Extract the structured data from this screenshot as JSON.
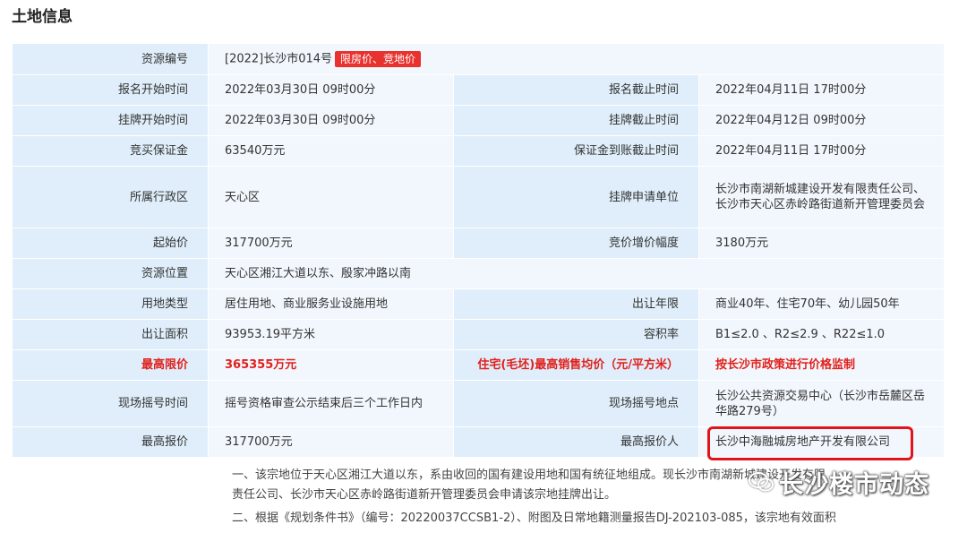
{
  "section_title": "土地信息",
  "rows": {
    "r1": {
      "l1": "资源编号",
      "v1": "[2022]长沙市014号",
      "tag": "限房价、竞地价"
    },
    "r2": {
      "l1": "报名开始时间",
      "v1": "2022年03月30日 09时00分",
      "l2": "报名截止时间",
      "v2": "2022年04月11日 17时00分"
    },
    "r3": {
      "l1": "挂牌开始时间",
      "v1": "2022年03月30日 09时00分",
      "l2": "挂牌截止时间",
      "v2": "2022年04月12日 09时00分"
    },
    "r4": {
      "l1": "竞买保证金",
      "v1": "63540万元",
      "l2": "保证金到账截止时间",
      "v2": "2022年04月11日 17时00分"
    },
    "r5": {
      "l1": "所属行政区",
      "v1": "天心区",
      "l2": "挂牌申请单位",
      "v2": "长沙市南湖新城建设开发有限责任公司、长沙市天心区赤岭路街道新开管理委员会"
    },
    "r6": {
      "l1": "起始价",
      "v1": "317700万元",
      "l2": "竞价增价幅度",
      "v2": "3180万元"
    },
    "r7": {
      "l1": "资源位置",
      "v1": "天心区湘江大道以东、殷家冲路以南"
    },
    "r8": {
      "l1": "用地类型",
      "v1": "居住用地、商业服务业设施用地",
      "l2": "出让年限",
      "v2": "商业40年、住宅70年、幼儿园50年"
    },
    "r9": {
      "l1": "出让面积",
      "v1": "93953.19平方米",
      "l2": "容积率",
      "v2": "B1≤2.0 、R2≤2.9 、R22≤1.0"
    },
    "r10": {
      "l1": "最高限价",
      "v1": "365355万元",
      "l2": "住宅(毛坯)最高销售均价（元/平方米）",
      "v2": "按长沙市政策进行价格监制"
    },
    "r11": {
      "l1": "现场摇号时间",
      "v1": "摇号资格审查公示结束后三个工作日内",
      "l2": "现场摇号地点",
      "v2": "长沙公共资源交易中心（长沙市岳麓区岳华路279号）"
    },
    "r12": {
      "l1": "最高报价",
      "v1": "317700万元",
      "l2": "最高报价人",
      "v2": "长沙中海融城房地产开发有限公司"
    }
  },
  "description": {
    "line1": "一、该宗地位于天心区湘江大道以东，系由收回的国有建设用地和国有统征地组成。现长沙市南湖新城建设开发有限",
    "line2": "责任公司、长沙市天心区赤岭路街道新开管理委员会申请该宗地挂牌出让。",
    "line3": "二、根据《规划条件书》（编号：20220037CCSB1-2）、附图及日常地籍测量报告DJ-202103-085，该宗地有效面积"
  },
  "watermark": {
    "text": "长沙楼市动态",
    "icon": "wechat-icon"
  },
  "colors": {
    "label_bg": "#dfeefa",
    "value_bg": "#f2f7fd",
    "accent_red": "#e0201b",
    "tag_red": "#e8322e"
  }
}
